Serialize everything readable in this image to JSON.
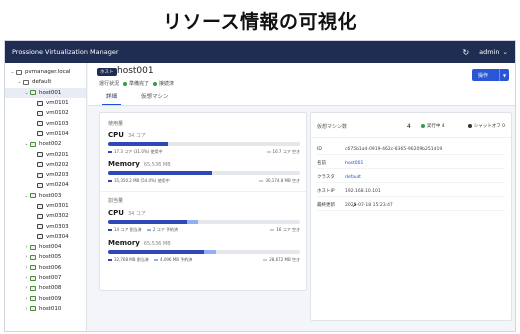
{
  "banner": {
    "title": "リソース情報の可視化"
  },
  "topbar": {
    "app_title": "Prossione Virtualization Manager",
    "refresh_icon": "↻",
    "user": "admin"
  },
  "sidebar": {
    "items": [
      {
        "label": "pvmanager.local",
        "level": 0,
        "kind": "dc",
        "chev": "⌄"
      },
      {
        "label": "default",
        "level": 1,
        "kind": "dc",
        "chev": "⌄"
      },
      {
        "label": "host001",
        "level": 2,
        "kind": "host",
        "chev": "⌄",
        "selected": true
      },
      {
        "label": "vm0101",
        "level": 3,
        "kind": "vm"
      },
      {
        "label": "vm0102",
        "level": 3,
        "kind": "vm"
      },
      {
        "label": "vm0103",
        "level": 3,
        "kind": "vm"
      },
      {
        "label": "vm0104",
        "level": 3,
        "kind": "vm"
      },
      {
        "label": "host002",
        "level": 2,
        "kind": "host",
        "chev": "⌄"
      },
      {
        "label": "vm0201",
        "level": 3,
        "kind": "vm"
      },
      {
        "label": "vm0202",
        "level": 3,
        "kind": "vm"
      },
      {
        "label": "vm0203",
        "level": 3,
        "kind": "vm"
      },
      {
        "label": "vm0204",
        "level": 3,
        "kind": "vm"
      },
      {
        "label": "host003",
        "level": 2,
        "kind": "host",
        "chev": "⌄"
      },
      {
        "label": "vm0301",
        "level": 3,
        "kind": "vm"
      },
      {
        "label": "vm0302",
        "level": 3,
        "kind": "vm"
      },
      {
        "label": "vm0303",
        "level": 3,
        "kind": "vm"
      },
      {
        "label": "vm0304",
        "level": 3,
        "kind": "vm"
      },
      {
        "label": "host004",
        "level": 2,
        "kind": "host",
        "chev": "›"
      },
      {
        "label": "host005",
        "level": 2,
        "kind": "host",
        "chev": "›"
      },
      {
        "label": "host006",
        "level": 2,
        "kind": "host",
        "chev": "›"
      },
      {
        "label": "host007",
        "level": 2,
        "kind": "host",
        "chev": "›"
      },
      {
        "label": "host008",
        "level": 2,
        "kind": "host",
        "chev": "›"
      },
      {
        "label": "host009",
        "level": 2,
        "kind": "host",
        "chev": "›"
      },
      {
        "label": "host010",
        "level": 2,
        "kind": "host",
        "chev": "›"
      }
    ]
  },
  "header": {
    "tag": "ホスト",
    "name": "host001",
    "run_label": "運行状況",
    "run_value": "準備完了",
    "conn_value": "接続済",
    "op_button": "操作",
    "tabs": [
      "詳細",
      "仮想マシン"
    ]
  },
  "usage": {
    "section_title": "使用量",
    "cpu": {
      "label": "CPU",
      "total": "34 コア",
      "used_fraction": 0.31,
      "used_text": "17.3 コア (31.0%) 使用中",
      "free_text": "16.7 コア 空き"
    },
    "memory": {
      "label": "Memory",
      "total": "65,536 MB",
      "used_fraction": 0.54,
      "used_text": "35,350.2 MB (54.0%) 使用中",
      "free_text": "30,174.8 MB 空き"
    }
  },
  "allocation": {
    "section_title": "割当量",
    "cpu": {
      "label": "CPU",
      "total": "34 コア",
      "alloc_fraction": 0.41,
      "reserve_fraction": 0.06,
      "alloc_text": "14 コア 割当済",
      "reserve_text": "2 コア 予約済",
      "free_text": "16 コア 空き"
    },
    "memory": {
      "label": "Memory",
      "total": "65,536 MB",
      "alloc_fraction": 0.5,
      "reserve_fraction": 0.06,
      "alloc_text": "32,768 MB 割当済",
      "reserve_text": "4,096 MB 予約済",
      "free_text": "28,672 MB 空き"
    }
  },
  "vms": {
    "title": "仮想マシン数",
    "count": "4",
    "running": "実行中 4",
    "shutoff": "シャットオフ 0"
  },
  "props": [
    {
      "key": "ID",
      "value": "c675b1a4-0919-462c-8365-96209b251d19",
      "link": false
    },
    {
      "key": "名前",
      "value": "host001",
      "link": true
    },
    {
      "key": "クラスタ",
      "value": "default",
      "link": true
    },
    {
      "key": "ホストIP",
      "value": "192.168.10.101",
      "link": false
    },
    {
      "key": "最終更新",
      "value": "2025-07-18 15:23:47",
      "link": false
    }
  ],
  "colors": {
    "topbar": "#1f2d52",
    "primary": "#2a56d6",
    "bar_used": "#2f48b8",
    "bar_reserved": "#8fb0f5",
    "ok": "#2f9e44"
  }
}
